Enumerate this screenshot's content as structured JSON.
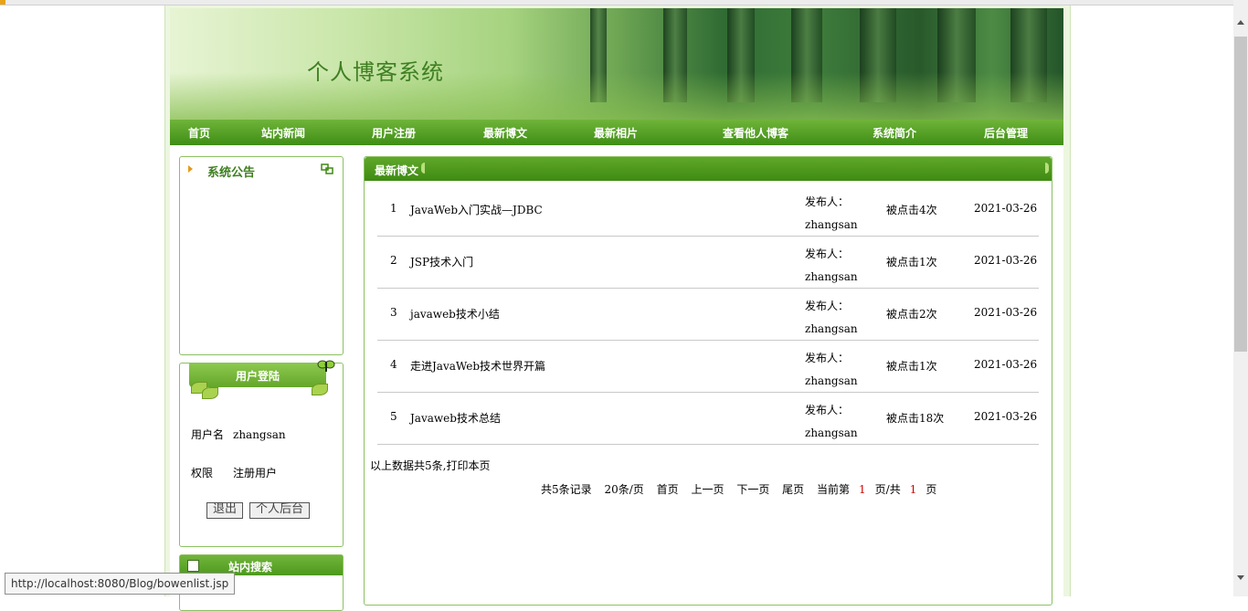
{
  "site": {
    "title": "个人博客系统"
  },
  "nav": [
    {
      "label": "首页"
    },
    {
      "label": "站内新闻"
    },
    {
      "label": "用户注册"
    },
    {
      "label": "最新博文"
    },
    {
      "label": "最新相片"
    },
    {
      "label": "查看他人博客"
    },
    {
      "label": "系统简介"
    },
    {
      "label": "后台管理"
    }
  ],
  "sidebar": {
    "notice_title": "系统公告",
    "login": {
      "title": "用户登陆",
      "username_label": "用户名",
      "username_value": "zhangsan",
      "role_label": "权限",
      "role_value": "注册用户",
      "logout_button": "退出",
      "admin_button": "个人后台"
    },
    "search_title": "站内搜索"
  },
  "main": {
    "title": "最新博文",
    "rows": [
      {
        "num": "1",
        "title": "JavaWeb入门实战—JDBC",
        "publisher_label": "发布人：",
        "publisher": "zhangsan",
        "clicks": "被点击4次",
        "date": "2021-03-26"
      },
      {
        "num": "2",
        "title": "JSP技术入门",
        "publisher_label": "发布人：",
        "publisher": "zhangsan",
        "clicks": "被点击1次",
        "date": "2021-03-26"
      },
      {
        "num": "3",
        "title": "javaweb技术小结",
        "publisher_label": "发布人：",
        "publisher": "zhangsan",
        "clicks": "被点击2次",
        "date": "2021-03-26"
      },
      {
        "num": "4",
        "title": "走进JavaWeb技术世界开篇",
        "publisher_label": "发布人：",
        "publisher": "zhangsan",
        "clicks": "被点击1次",
        "date": "2021-03-26"
      },
      {
        "num": "5",
        "title": "Javaweb技术总结",
        "publisher_label": "发布人：",
        "publisher": "zhangsan",
        "clicks": "被点击18次",
        "date": "2021-03-26"
      }
    ],
    "summary": "以上数据共5条,打印本页",
    "pager": {
      "total": "共5条记录",
      "per_page": "20条/页",
      "first": "首页",
      "prev": "上一页",
      "next": "下一页",
      "last": "尾页",
      "current_prefix": "当前第",
      "current_page": "1",
      "current_mid": "页/共",
      "total_pages": "1",
      "current_suffix": "页"
    }
  },
  "statusbar": {
    "url": "http://localhost:8080/Blog/bowenlist.jsp"
  },
  "colors": {
    "nav_green": "#4c9a1d",
    "title_green": "#3f7f21",
    "border_green": "#8cc063"
  }
}
